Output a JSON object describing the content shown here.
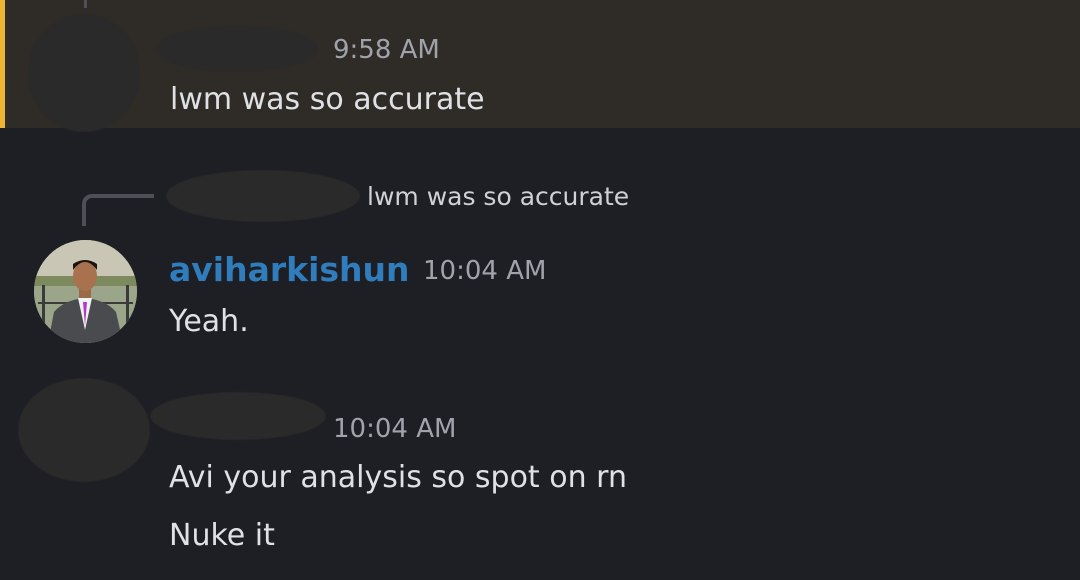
{
  "messages": [
    {
      "author": "",
      "timestamp": "9:58 AM",
      "text": "lwm was so accurate",
      "highlighted": true
    },
    {
      "reply_to": {
        "author": "",
        "text": "lwm was so accurate"
      },
      "author": "aviharkishun",
      "author_color": "#2f7dbd",
      "timestamp": "10:04 AM",
      "text": "Yeah."
    },
    {
      "author": "",
      "timestamp": "10:04 AM",
      "lines": [
        "Avi your analysis so spot on rn",
        "Nuke it"
      ]
    }
  ],
  "colors": {
    "background": "#1e1f24",
    "highlight_background": "#2f2c27",
    "highlight_bar": "#f0b232",
    "username": "#2f7dbd",
    "text": "#dfe1e5",
    "timestamp": "#a0a3ab"
  }
}
